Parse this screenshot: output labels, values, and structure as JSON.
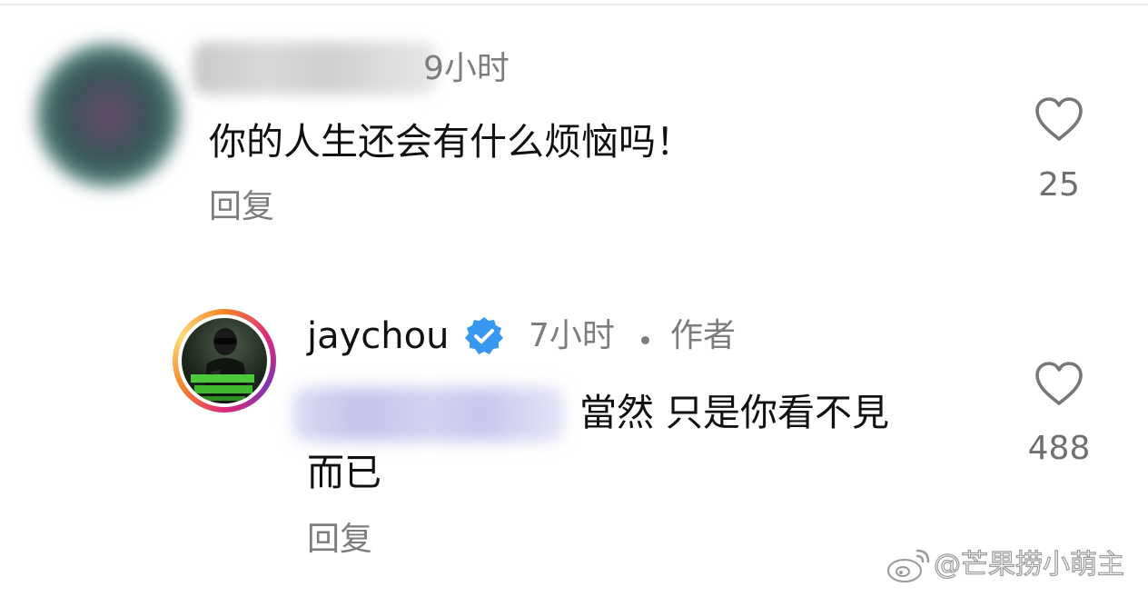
{
  "comments": [
    {
      "time": "9小时",
      "text": "你的人生还会有什么烦恼吗！",
      "reply_label": "回复",
      "like_icon": "heart-outline-icon",
      "likes": "25"
    },
    {
      "username": "jaychou",
      "verified_icon": "verified-badge-icon",
      "time": "7小时",
      "author_tag": "作者",
      "text_line1": "當然 只是你看不見",
      "text_line2": "而已",
      "reply_label": "回复",
      "like_icon": "heart-outline-icon",
      "likes": "488"
    }
  ],
  "watermark": {
    "icon": "weibo-icon",
    "text": "@芒果捞小萌主"
  },
  "colors": {
    "verified_blue": "#3897f0",
    "secondary_text": "#7d7d7d",
    "primary_text": "#111111",
    "avatar_ring": "#dd2a7b"
  }
}
